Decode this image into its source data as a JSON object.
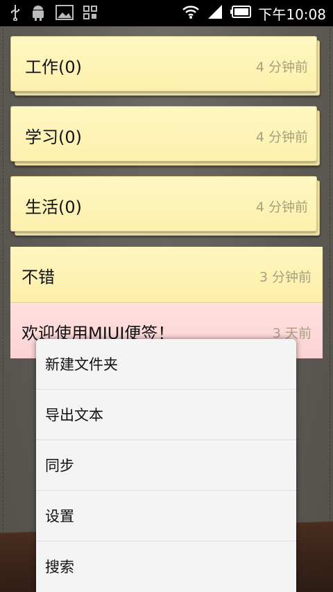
{
  "status_bar": {
    "time": "下午10:08",
    "icons_left": [
      "usb-icon",
      "android-icon",
      "image-icon",
      "apps-icon"
    ],
    "icons_right": [
      "wifi-icon",
      "signal-icon",
      "battery-icon"
    ]
  },
  "folders": [
    {
      "name": "工作(0)",
      "time": "4 分钟前"
    },
    {
      "name": "学习(0)",
      "time": "4 分钟前"
    },
    {
      "name": "生活(0)",
      "time": "4 分钟前"
    }
  ],
  "notes": [
    {
      "title": "不错",
      "time": "3 分钟前",
      "color": "#fdf0ad"
    },
    {
      "title": "欢迎使用MIUI便签！",
      "time": "3 天前",
      "color": "#fbd5d6"
    }
  ],
  "menu": {
    "items": [
      "新建文件夹",
      "导出文本",
      "同步",
      "设置",
      "搜索"
    ]
  }
}
